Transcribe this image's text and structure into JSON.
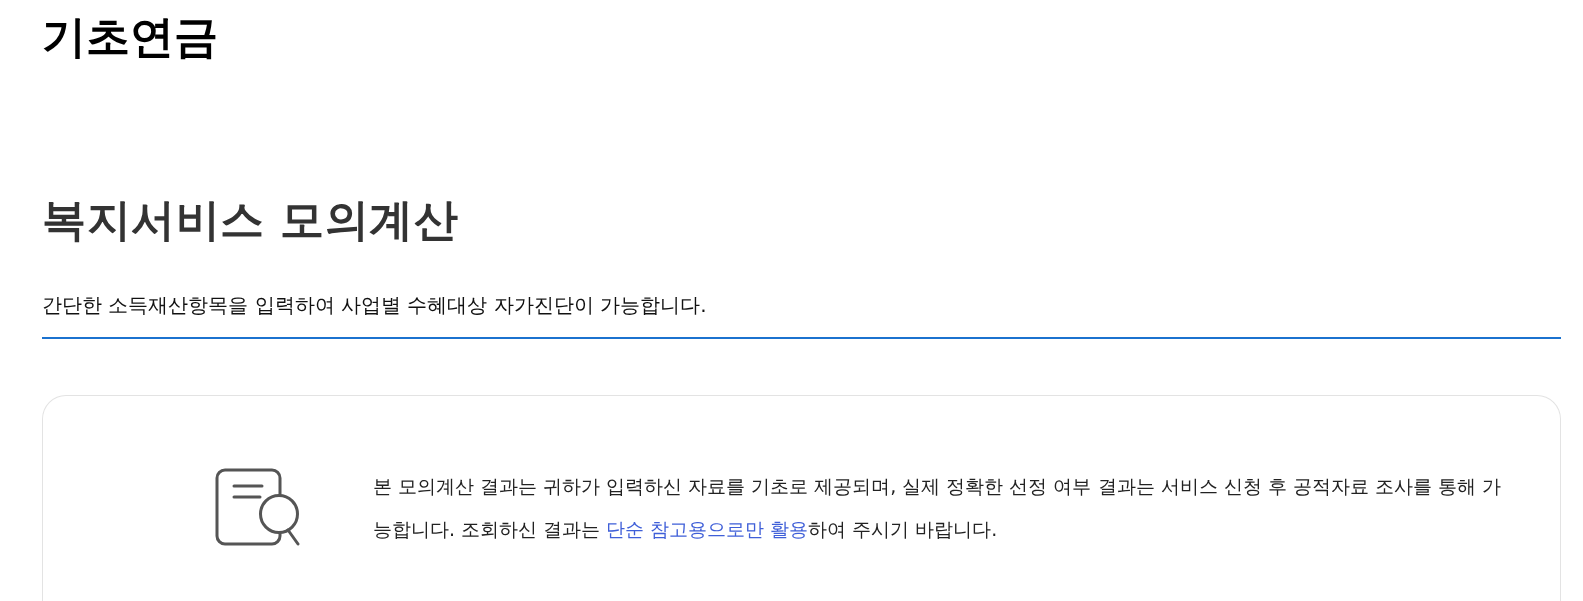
{
  "page_title": "기초연금",
  "section": {
    "title": "복지서비스 모의계산",
    "description": "간단한 소득재산항목을 입력하여 사업별 수혜대상 자가진단이 가능합니다."
  },
  "notice": {
    "text_before": "본 모의계산 결과는 귀하가 입력하신 자료를 기초로 제공되며, 실제 정확한 선정 여부 결과는 서비스 신청 후 공적자료 조사를 통해 가능합니다. 조회하신 결과는 ",
    "link": "단순 참고용으로만 활용",
    "text_after": "하여 주시기 바랍니다."
  }
}
